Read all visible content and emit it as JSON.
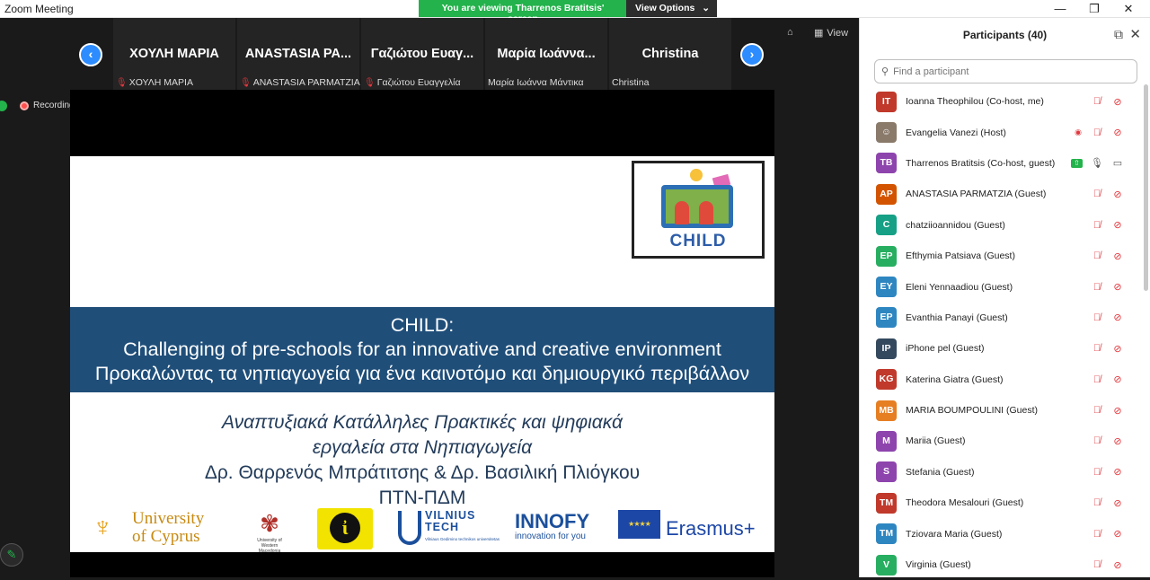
{
  "window": {
    "title": "Zoom Meeting",
    "share_banner": "You are viewing Tharrenos Bratitsis' screen",
    "view_options": "View Options",
    "controls": {
      "minimize": "—",
      "maximize": "❐",
      "close": "✕"
    }
  },
  "video": {
    "view_label": "View",
    "recording_label": "Recording",
    "thumbnails": [
      {
        "big": "ΧΟΥΛΗ ΜΑΡΙΑ",
        "small": "ΧΟΥΛΗ ΜΑΡΙΑ",
        "muted": true
      },
      {
        "big": "ANASTASIA PA...",
        "small": "ANASTASIA PARMATZIA",
        "muted": true
      },
      {
        "big": "Γαζιώτου Ευαγ...",
        "small": "Γαζιώτου Ευαγγελία",
        "muted": true
      },
      {
        "big": "Μαρία Ιωάννα...",
        "small": "Μαρία Ιωάννα Μάντικα",
        "muted": false
      },
      {
        "big": "Christina",
        "small": "Christina",
        "muted": false
      }
    ]
  },
  "slide": {
    "logo_word": "CHILD",
    "banner": [
      "CHILD:",
      "Challenging of pre-schools for an innovative and creative environment",
      "Προκαλώντας τα νηπιαγωγεία για ένα καινοτόμο και δημιουργικό περιβάλλον"
    ],
    "body_italic": [
      "Αναπτυξιακά Κατάλληλες Πρακτικές και ψηφιακά",
      "εργαλεία στα Νηπιαγωγεία"
    ],
    "body_normal": [
      "Δρ. Θαρρενός Μπράτιτσης & Δρ. Βασιλική Πλιόγκου",
      "ΠΤΝ-ΠΔΜ"
    ],
    "logos": {
      "ucy_line1": "University",
      "ucy_line2": "of Cyprus",
      "uowm_caption": "University of Western Macedonia",
      "ie_letter": "ἰ",
      "vt_line1": "VILNIUS",
      "vt_line2": "TECH",
      "vt_sub": "Vilniaus Gedimino technikos universitetas",
      "innofy": "INNOFY",
      "innofy_sub": "innovation for you",
      "erasmus": "Erasmus+"
    }
  },
  "participants": {
    "title": "Participants (40)",
    "search_placeholder": "Find a participant",
    "list": [
      {
        "initials": "IT",
        "name": "Ioanna Theophilou (Co-host, me)",
        "color": "#c0392b",
        "mic": "muted",
        "cam": "off"
      },
      {
        "initials": "",
        "name": "Evangelia Vanezi (Host)",
        "color": "#8a7a6a",
        "mic": "muted",
        "cam": "off",
        "recording": true,
        "photo": true
      },
      {
        "initials": "TB",
        "name": "Tharrenos Bratitsis (Co-host, guest)",
        "color": "#8e44ad",
        "mic": "on",
        "cam": "on",
        "sharing": true
      },
      {
        "initials": "AP",
        "name": "ANASTASIA PARMATZIA (Guest)",
        "color": "#d35400",
        "mic": "muted",
        "cam": "off"
      },
      {
        "initials": "C",
        "name": "chatziioannidou (Guest)",
        "color": "#16a085",
        "mic": "muted",
        "cam": "off"
      },
      {
        "initials": "EP",
        "name": "Efthymia Patsiava (Guest)",
        "color": "#27ae60",
        "mic": "muted",
        "cam": "off"
      },
      {
        "initials": "EY",
        "name": "Eleni Yennaadiou (Guest)",
        "color": "#2e86c1",
        "mic": "muted",
        "cam": "off"
      },
      {
        "initials": "EP",
        "name": "Evanthia Panayi (Guest)",
        "color": "#2e86c1",
        "mic": "muted",
        "cam": "off"
      },
      {
        "initials": "IP",
        "name": "iPhone pel (Guest)",
        "color": "#34495e",
        "mic": "muted",
        "cam": "off"
      },
      {
        "initials": "KG",
        "name": "Katerina Giatra (Guest)",
        "color": "#c0392b",
        "mic": "muted",
        "cam": "off"
      },
      {
        "initials": "MB",
        "name": "MARIA BOUMPOULINI (Guest)",
        "color": "#e67e22",
        "mic": "muted",
        "cam": "off"
      },
      {
        "initials": "M",
        "name": "Mariia (Guest)",
        "color": "#8e44ad",
        "mic": "muted",
        "cam": "off"
      },
      {
        "initials": "S",
        "name": "Stefania (Guest)",
        "color": "#8e44ad",
        "mic": "muted",
        "cam": "off"
      },
      {
        "initials": "TM",
        "name": "Theodora Mesalouri (Guest)",
        "color": "#c0392b",
        "mic": "muted",
        "cam": "off"
      },
      {
        "initials": "TM",
        "name": "Tziovara Maria (Guest)",
        "color": "#2e86c1",
        "mic": "muted",
        "cam": "off"
      },
      {
        "initials": "V",
        "name": "Virginia (Guest)",
        "color": "#27ae60",
        "mic": "muted",
        "cam": "off"
      }
    ]
  }
}
